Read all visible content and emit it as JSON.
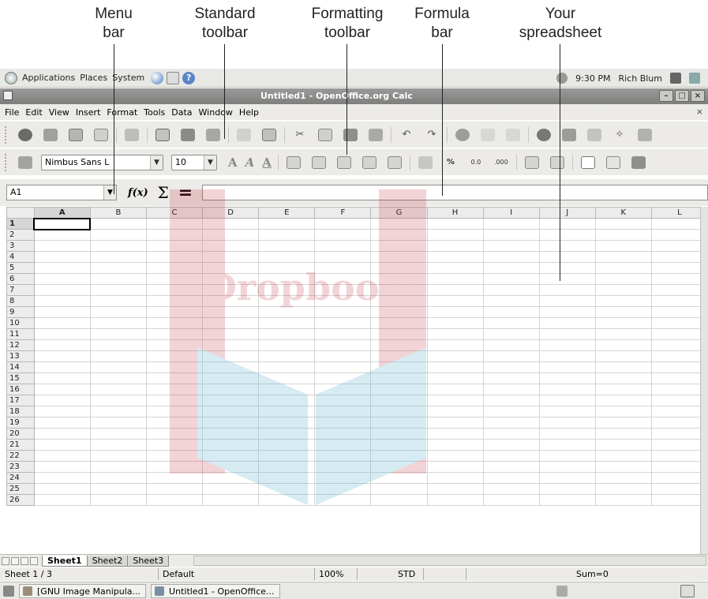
{
  "callouts": [
    {
      "line1": "Menu",
      "line2": "bar"
    },
    {
      "line1": "Standard",
      "line2": "toolbar"
    },
    {
      "line1": "Formatting",
      "line2": "toolbar"
    },
    {
      "line1": "Formula",
      "line2": "bar"
    },
    {
      "line1": "Your",
      "line2": "spreadsheet"
    }
  ],
  "watermark": "Dropbooks",
  "topbar": {
    "applications": "Applications",
    "places": "Places",
    "system": "System",
    "time": "9:30 PM",
    "user": "Rich Blum"
  },
  "window": {
    "title": "Untitled1 - OpenOffice.org Calc"
  },
  "menubar": [
    "File",
    "Edit",
    "View",
    "Insert",
    "Format",
    "Tools",
    "Data",
    "Window",
    "Help"
  ],
  "menubar_close": "×",
  "formatting": {
    "font_name": "Nimbus Sans L",
    "font_size": "10"
  },
  "formula": {
    "name_box": "A1",
    "fx": "f(x)",
    "sigma": "Σ",
    "equals": "=",
    "value": ""
  },
  "columns": [
    "A",
    "B",
    "C",
    "D",
    "E",
    "F",
    "G",
    "H",
    "I",
    "J",
    "K",
    "L"
  ],
  "rows": [
    "1",
    "2",
    "3",
    "4",
    "5",
    "6",
    "7",
    "8",
    "9",
    "10",
    "11",
    "12",
    "13",
    "14",
    "15",
    "16",
    "17",
    "18",
    "19",
    "20",
    "21",
    "22",
    "23",
    "24",
    "25",
    "26"
  ],
  "active_cell": "A1",
  "sheets": [
    "Sheet1",
    "Sheet2",
    "Sheet3"
  ],
  "active_sheet": "Sheet1",
  "statusbar": {
    "sheet": "Sheet 1 / 3",
    "style": "Default",
    "zoom": "100%",
    "mode": "STD",
    "sum": "Sum=0"
  },
  "taskbar": [
    "[GNU Image Manipula...",
    "Untitled1 - OpenOffice..."
  ],
  "colors": {
    "titlebar": "#8a8a88",
    "toolbar_bg": "#ecebe7",
    "header_bg": "#ececec",
    "watermark": "#c73a4a"
  }
}
